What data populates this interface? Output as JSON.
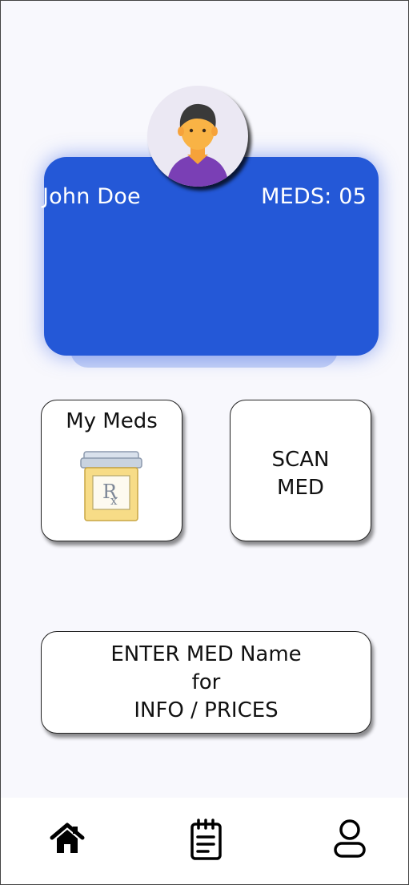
{
  "profile": {
    "name": "John Doe",
    "meds_count": "MEDS: 05"
  },
  "tiles": {
    "my_meds": {
      "label": "My Meds",
      "icon": "pill-bottle-icon"
    },
    "scan_med": {
      "line1": "SCAN",
      "line2": "MED"
    },
    "enter_med": {
      "line1": "ENTER MED Name",
      "line2": "for",
      "line3": "INFO / PRICES"
    }
  },
  "nav": {
    "items": [
      {
        "icon": "home-icon"
      },
      {
        "icon": "notepad-icon"
      },
      {
        "icon": "user-icon"
      }
    ]
  },
  "colors": {
    "card_blue": "#2458d7",
    "background": "#f8f8fd"
  }
}
